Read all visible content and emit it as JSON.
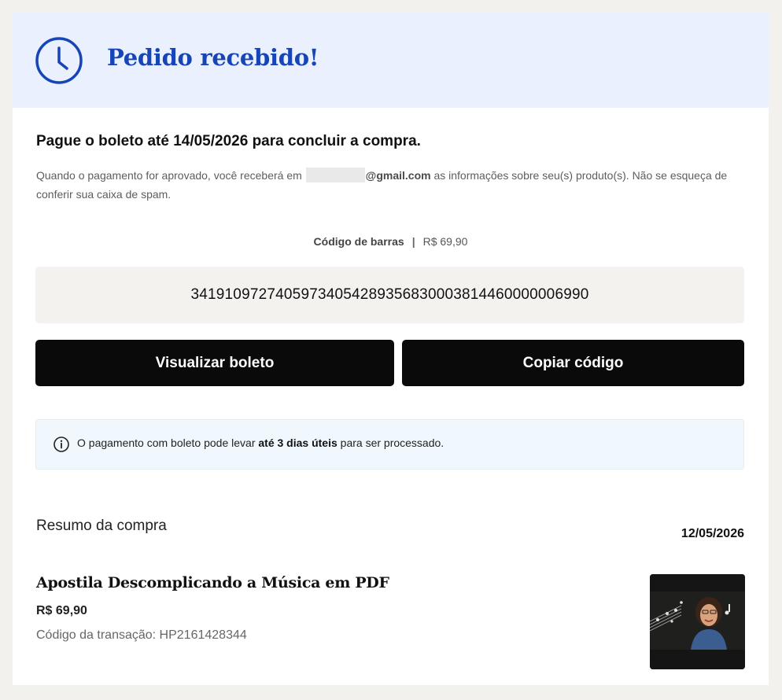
{
  "header": {
    "title": "Pedido recebido!",
    "icon": "clock-icon",
    "accent_color": "#1745b7",
    "background_color": "#eaf0fd"
  },
  "payment": {
    "headline": "Pague o boleto até 14/05/2026 para concluir a compra.",
    "desc_before": "Quando o pagamento for aprovado, você receberá em ",
    "email_domain": "@gmail.com",
    "desc_after": " as informações sobre seu(s) produto(s). Não se esqueça de conferir sua caixa de spam."
  },
  "barcode": {
    "label": "Código de barras",
    "separator": "|",
    "amount": "R$ 69,90",
    "code": "34191097274059734054289356830003814460000006990"
  },
  "actions": {
    "view_label": "Visualizar boleto",
    "copy_label": "Copiar código"
  },
  "info": {
    "icon": "info-icon",
    "text_before": "O pagamento com boleto pode levar ",
    "text_bold": "até 3 dias úteis",
    "text_after": " para ser processado."
  },
  "summary": {
    "title": "Resumo da compra",
    "date": "12/05/2026",
    "product_name": "Apostila Descomplicando a Música em PDF",
    "price": "R$ 69,90",
    "transaction": "Código da transação: HP2161428344"
  }
}
